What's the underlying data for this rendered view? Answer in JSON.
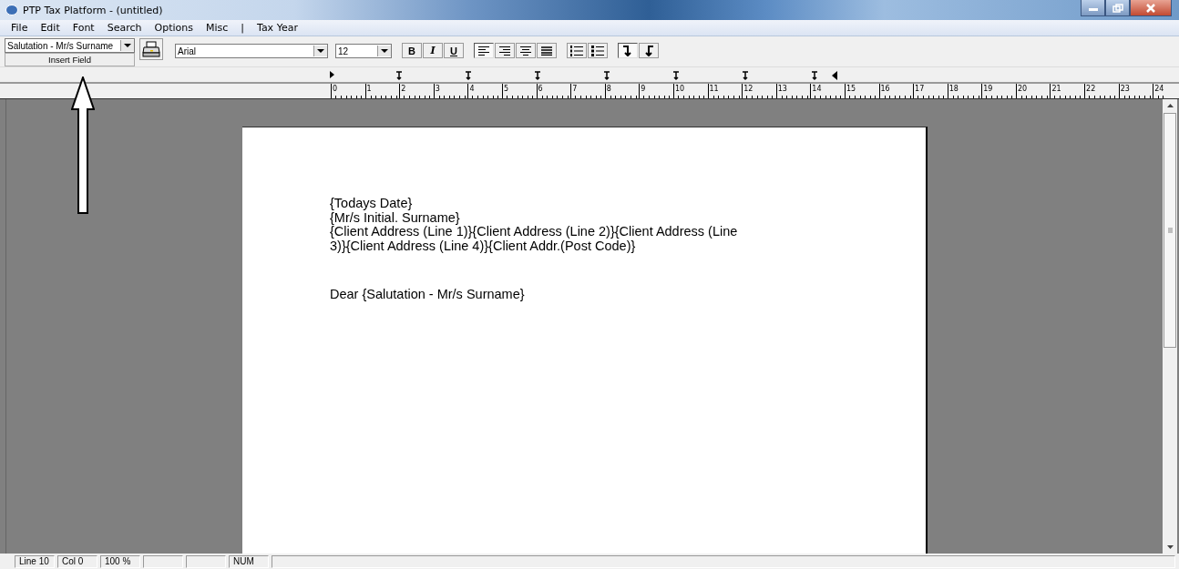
{
  "window": {
    "title": "PTP Tax Platform - (untitled)"
  },
  "menu": [
    "File",
    "Edit",
    "Font",
    "Search",
    "Options",
    "Misc",
    "|",
    "Tax Year"
  ],
  "field_picker": {
    "value": "Salutation - Mr/s Surname",
    "button": "Insert Field"
  },
  "font": {
    "value": "Arial"
  },
  "size": {
    "value": "12"
  },
  "style_buttons": [
    {
      "label": "B",
      "kind": "bold"
    },
    {
      "label": "I",
      "kind": "italic"
    },
    {
      "label": "U",
      "kind": "underline"
    }
  ],
  "align_buttons": [
    {
      "kind": "left",
      "selected": true
    },
    {
      "kind": "right",
      "selected": false
    },
    {
      "kind": "center",
      "selected": false
    },
    {
      "kind": "justify",
      "selected": false
    }
  ],
  "list_buttons": [
    {
      "kind": "numbered"
    },
    {
      "kind": "bulleted"
    }
  ],
  "para_buttons": [
    {
      "kind": "tab-left",
      "selected": true
    },
    {
      "kind": "tab-right",
      "selected": false
    }
  ],
  "ruler": [
    "0",
    "1",
    "2",
    "3",
    "4",
    "5",
    "6",
    "7",
    "8",
    "9",
    "10",
    "11",
    "12",
    "13",
    "14",
    "15",
    "16",
    "17",
    "18",
    "19",
    "20",
    "21",
    "22",
    "23",
    "24"
  ],
  "document": {
    "paragraphs": [
      {
        "lines": [
          "{Todays Date}",
          "{Mr/s Initial. Surname}",
          "{Client Address (Line 1)}{Client Address (Line 2)}{Client Address (Line",
          "3)}{Client Address (Line 4)}{Client Addr.(Post Code)}"
        ]
      },
      {
        "lines": [
          "Dear {Salutation - Mr/s Surname}"
        ]
      }
    ]
  },
  "status_bar": [
    "Line 10",
    "Col 0",
    "100 %",
    "NUM"
  ]
}
